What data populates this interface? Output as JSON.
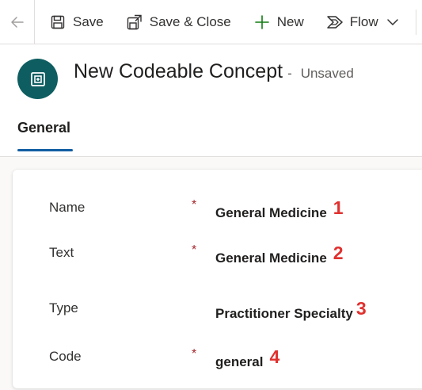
{
  "toolbar": {
    "back_icon": "arrow-left-icon",
    "save_label": "Save",
    "save_close_label": "Save & Close",
    "new_label": "New",
    "flow_label": "Flow"
  },
  "header": {
    "title": "New Codeable Concept",
    "separator": "-",
    "status": "Unsaved",
    "icon": "entity-icon"
  },
  "tabs": [
    {
      "label": "General",
      "selected": true
    }
  ],
  "form": {
    "fields": [
      {
        "label": "Name",
        "required": "*",
        "value": "General Medicine",
        "annotation": "1"
      },
      {
        "label": "Text",
        "required": "*",
        "value": "General Medicine",
        "annotation": "2"
      },
      {
        "label": "Type",
        "required": "",
        "value": "Practitioner Specialty",
        "annotation": "3"
      },
      {
        "label": "Code",
        "required": "*",
        "value": "general",
        "annotation": "4"
      }
    ]
  },
  "colors": {
    "accent": "#115ea3",
    "entity_icon_bg": "#0e5e61",
    "required": "#a4262c",
    "annotation": "#e0312f",
    "new_plus": "#107c10"
  }
}
